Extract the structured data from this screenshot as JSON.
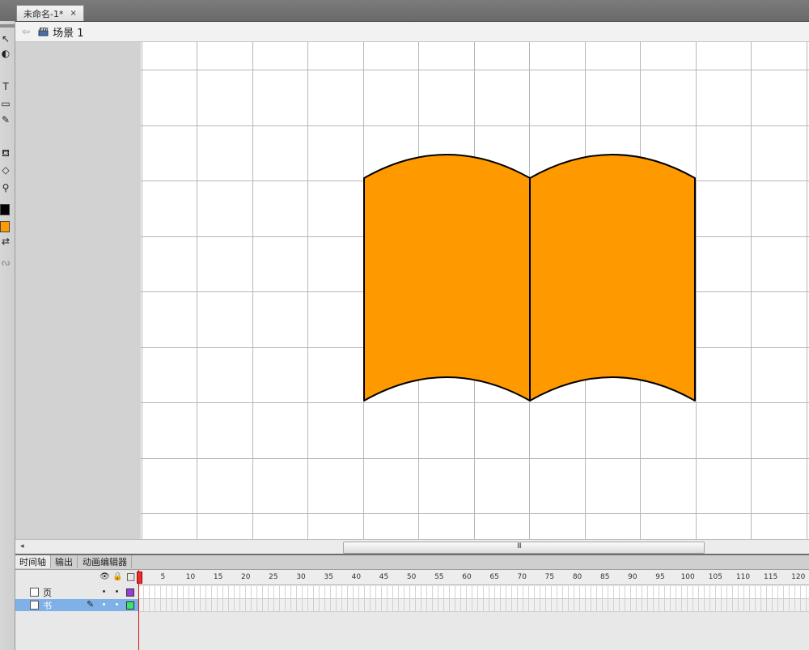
{
  "document": {
    "tab_title": "未命名-1*",
    "close_glyph": "×"
  },
  "breadcrumb": {
    "back_glyph": "⇦",
    "scene_label": "场景 1"
  },
  "tools": {
    "selection": "↖",
    "lasso": "◐",
    "text": "T",
    "rectangle": "▭",
    "pencil": "✎",
    "paint_bucket": "⛾",
    "eraser": "◇",
    "zoom": "⚲",
    "swap": "⇄",
    "snap": "ᔓ",
    "stroke_color": "#000000",
    "fill_color": "#ff9a00"
  },
  "stage": {
    "background": "#ffffff",
    "grid_color": "#b7b7b7",
    "shape_fill": "#ff9900",
    "shape_stroke": "#000000"
  },
  "scrollbar": {
    "left_arrow": "◂",
    "grip": "III"
  },
  "panel_tabs": [
    "时间轴",
    "输出",
    "动画编辑器"
  ],
  "timeline": {
    "header_icons": {
      "eye": "👁",
      "lock": "🔒",
      "outline": "□"
    },
    "ruler_labels": [
      "1",
      "5",
      "10",
      "15",
      "20",
      "25",
      "30",
      "35",
      "40",
      "45",
      "50",
      "55",
      "60",
      "65",
      "70",
      "75",
      "80",
      "85",
      "90",
      "95",
      "100",
      "105",
      "110",
      "115",
      "120"
    ],
    "layers": [
      {
        "name": "页",
        "color": "#9a3bd6",
        "selected": false
      },
      {
        "name": "书",
        "color": "#3ce36a",
        "selected": true
      }
    ],
    "edit_glyph": "✎",
    "current_frame": 1
  }
}
